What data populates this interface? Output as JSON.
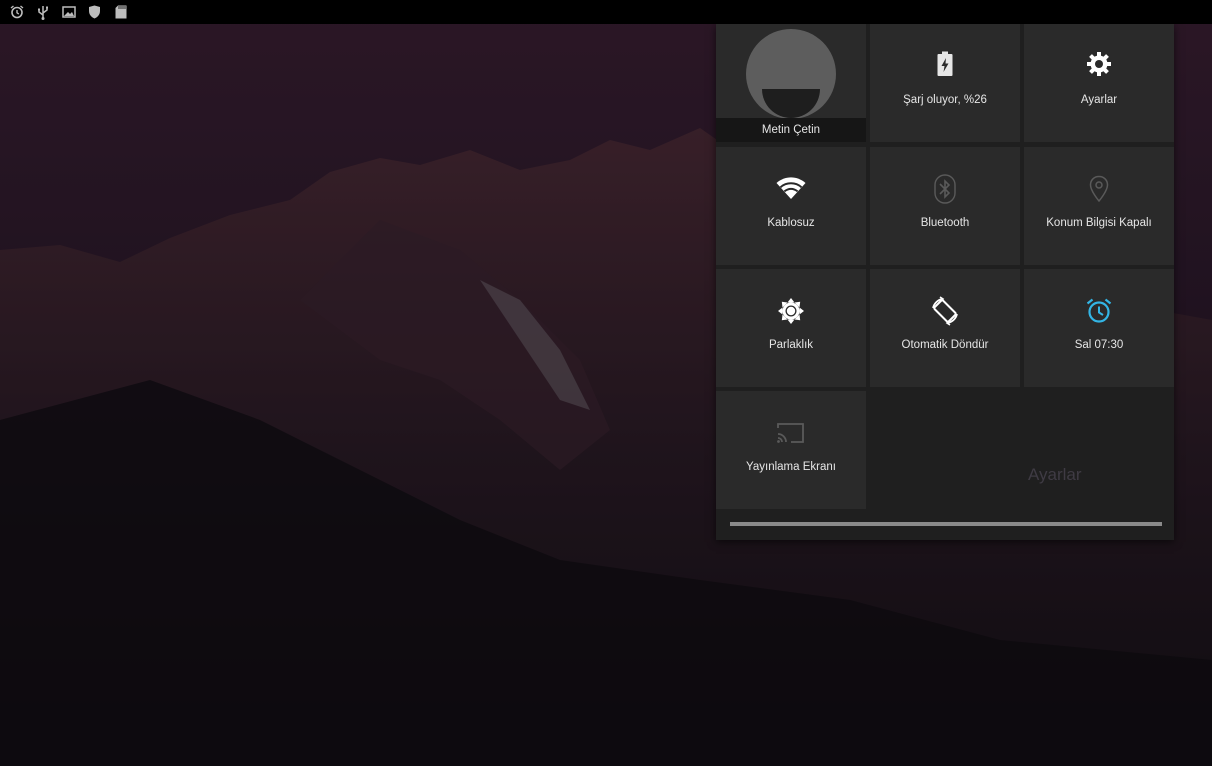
{
  "status_bar": {
    "icons": [
      "alarm-icon",
      "usb-icon",
      "image-icon",
      "shield-icon",
      "sd-card-icon"
    ]
  },
  "quick_settings": {
    "user": {
      "name": "Metin Çetin",
      "icon": "avatar-icon"
    },
    "tiles": [
      {
        "id": "battery",
        "icon": "battery-charging-icon",
        "label": "Şarj oluyor, %26",
        "state": "on"
      },
      {
        "id": "settings",
        "icon": "gear-icon",
        "label": "Ayarlar",
        "state": "on"
      },
      {
        "id": "wifi",
        "icon": "wifi-icon",
        "label": "Kablosuz",
        "state": "on"
      },
      {
        "id": "bluetooth",
        "icon": "bluetooth-icon",
        "label": "Bluetooth",
        "state": "off"
      },
      {
        "id": "location",
        "icon": "location-icon",
        "label": "Konum Bilgisi Kapalı",
        "state": "off"
      },
      {
        "id": "brightness",
        "icon": "brightness-icon",
        "label": "Parlaklık",
        "state": "on"
      },
      {
        "id": "rotate",
        "icon": "auto-rotate-icon",
        "label": "Otomatik Döndür",
        "state": "on"
      },
      {
        "id": "alarm",
        "icon": "alarm-icon",
        "label": "Sal 07:30",
        "state": "on"
      },
      {
        "id": "cast",
        "icon": "cast-icon",
        "label": "Yayınlama Ekranı",
        "state": "off"
      }
    ],
    "ghost_text": "Ayarlar"
  },
  "colors": {
    "accent_blue": "#33b5e5",
    "tile_bg": "#2a2a2a",
    "panel_bg": "#1f1f1f",
    "status_bar": "#000000"
  }
}
